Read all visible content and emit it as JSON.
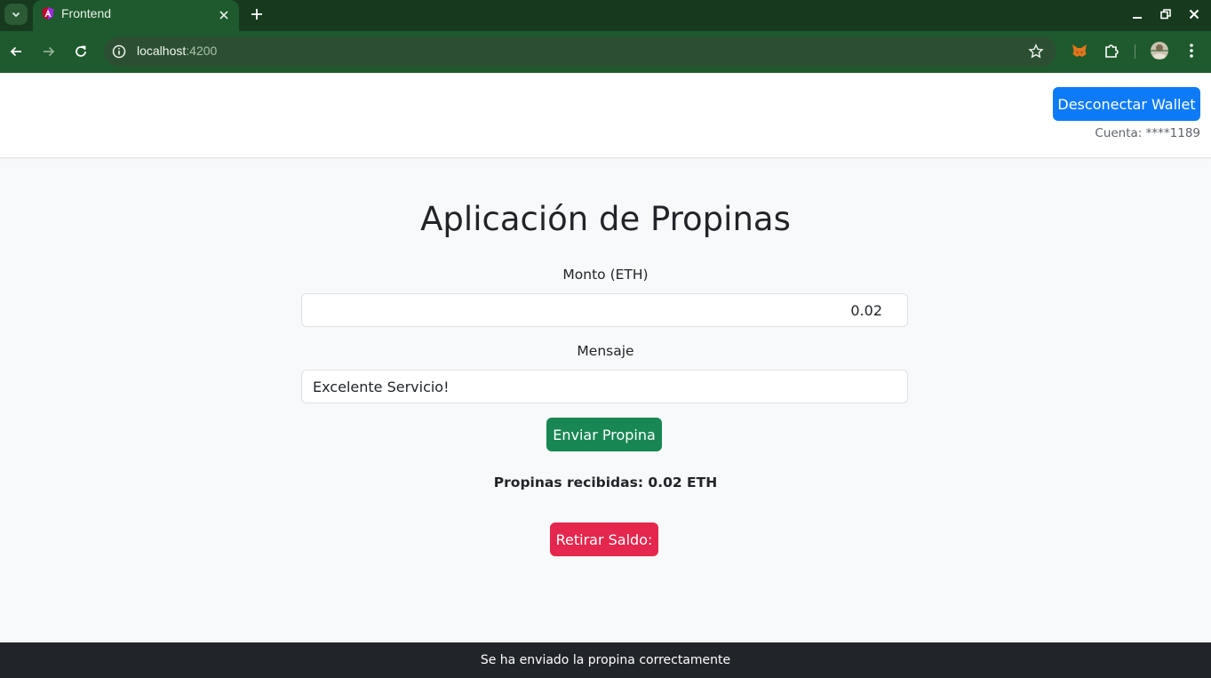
{
  "browser": {
    "tab_title": "Frontend",
    "url_host": "localhost",
    "url_port": ":4200"
  },
  "navbar": {
    "disconnect_label": "Desconectar Wallet",
    "account_text": "Cuenta: ****1189"
  },
  "main": {
    "title": "Aplicación de Propinas",
    "amount_label": "Monto (ETH)",
    "amount_value": "0.02",
    "message_label": "Mensaje",
    "message_value": "Excelente Servicio!",
    "send_label": "Enviar Propina",
    "tips_received": "Propinas recibidas: 0.02 ETH",
    "withdraw_label": "Retirar Saldo:"
  },
  "footer": {
    "status_text": "Se ha enviado la propina correctamente"
  },
  "colors": {
    "chrome_dark": "#173a1f",
    "chrome_green": "#1e5a2d",
    "primary": "#0d7bf8",
    "success": "#198754",
    "danger": "#e5264d",
    "footer": "#212529"
  }
}
